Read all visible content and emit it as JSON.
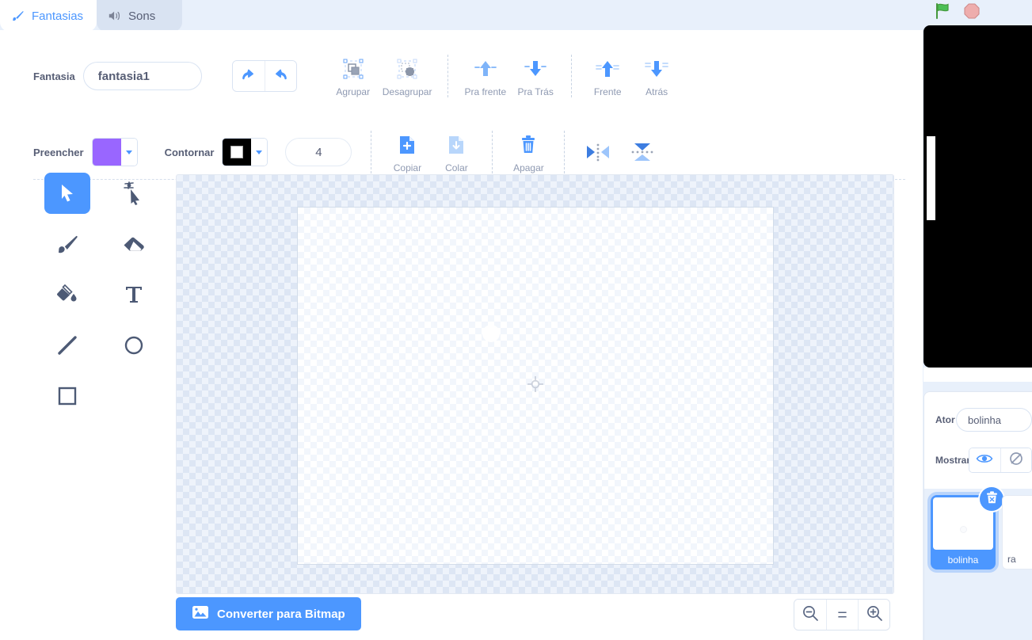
{
  "tabs": [
    {
      "label": "Fantasias",
      "icon": "paintbrush-icon",
      "active": true
    },
    {
      "label": "Sons",
      "icon": "speaker-icon",
      "active": false
    }
  ],
  "toolbar_row1": {
    "costume_name_label": "Fantasia",
    "costume_name_value": "fantasia1",
    "undo_icon": "undo-arrow-icon",
    "redo_icon": "redo-arrow-icon",
    "buttons": [
      {
        "label": "Agrupar",
        "icon": "group-icon",
        "enabled": false
      },
      {
        "label": "Desagrupar",
        "icon": "ungroup-icon",
        "enabled": false
      },
      {
        "label": "Pra frente",
        "icon": "forward-icon",
        "enabled": false
      },
      {
        "label": "Pra Trás",
        "icon": "backward-icon",
        "enabled": false
      },
      {
        "label": "Frente",
        "icon": "front-icon",
        "enabled": false
      },
      {
        "label": "Atrás",
        "icon": "back-icon",
        "enabled": false
      }
    ]
  },
  "toolbar_row2": {
    "fill_label": "Preencher",
    "fill_color": "#9966FF",
    "outline_label": "Contornar",
    "outline_color": "#000000",
    "stroke_width": "4",
    "buttons": [
      {
        "label": "Copiar",
        "icon": "copy-icon",
        "enabled": true
      },
      {
        "label": "Colar",
        "icon": "paste-icon",
        "enabled": false
      },
      {
        "label": "Apagar",
        "icon": "trash-icon",
        "enabled": true
      }
    ],
    "flip_horizontal_icon": "flip-horizontal-icon",
    "flip_vertical_icon": "flip-vertical-icon"
  },
  "palette": [
    {
      "name": "select-tool",
      "icon": "arrow-cursor-icon",
      "active": true
    },
    {
      "name": "reshape-tool",
      "icon": "reshape-node-icon",
      "active": false
    },
    {
      "name": "brush-tool",
      "icon": "paintbrush-icon",
      "active": false
    },
    {
      "name": "eraser-tool",
      "icon": "eraser-icon",
      "active": false
    },
    {
      "name": "fill-tool",
      "icon": "paint-bucket-icon",
      "active": false
    },
    {
      "name": "text-tool",
      "icon": "text-t-icon",
      "active": false
    },
    {
      "name": "line-tool",
      "icon": "line-icon",
      "active": false
    },
    {
      "name": "circle-tool",
      "icon": "circle-icon",
      "active": false
    },
    {
      "name": "rectangle-tool",
      "icon": "rectangle-icon",
      "active": false
    }
  ],
  "canvas": {
    "center_marker_icon": "crosshair-icon",
    "shape": "white-circle"
  },
  "bottom_bar": {
    "convert_label": "Converter para Bitmap",
    "convert_icon": "image-icon",
    "zoom_out_icon": "zoom-out-icon",
    "zoom_reset_label": "=",
    "zoom_in_icon": "zoom-in-icon"
  },
  "stage_controls": {
    "green_flag_icon": "green-flag-icon",
    "stop_icon": "stop-sign-icon"
  },
  "stage": {
    "background": "#000000",
    "paddle_color": "#ffffff"
  },
  "sprite_panel": {
    "actor_label": "Ator",
    "actor_name": "bolinha",
    "show_label": "Mostrar",
    "show_on_icon": "eye-icon",
    "show_off_icon": "eye-slash-icon",
    "sprites": [
      {
        "name": "bolinha",
        "selected": true,
        "delete_icon": "trash-badge-icon"
      },
      {
        "name": "ra",
        "selected": false
      }
    ]
  },
  "colors": {
    "accent": "#4c97ff",
    "text": "#575e75",
    "muted": "#8f9ab2",
    "panel_bg": "#e8f0fb"
  }
}
